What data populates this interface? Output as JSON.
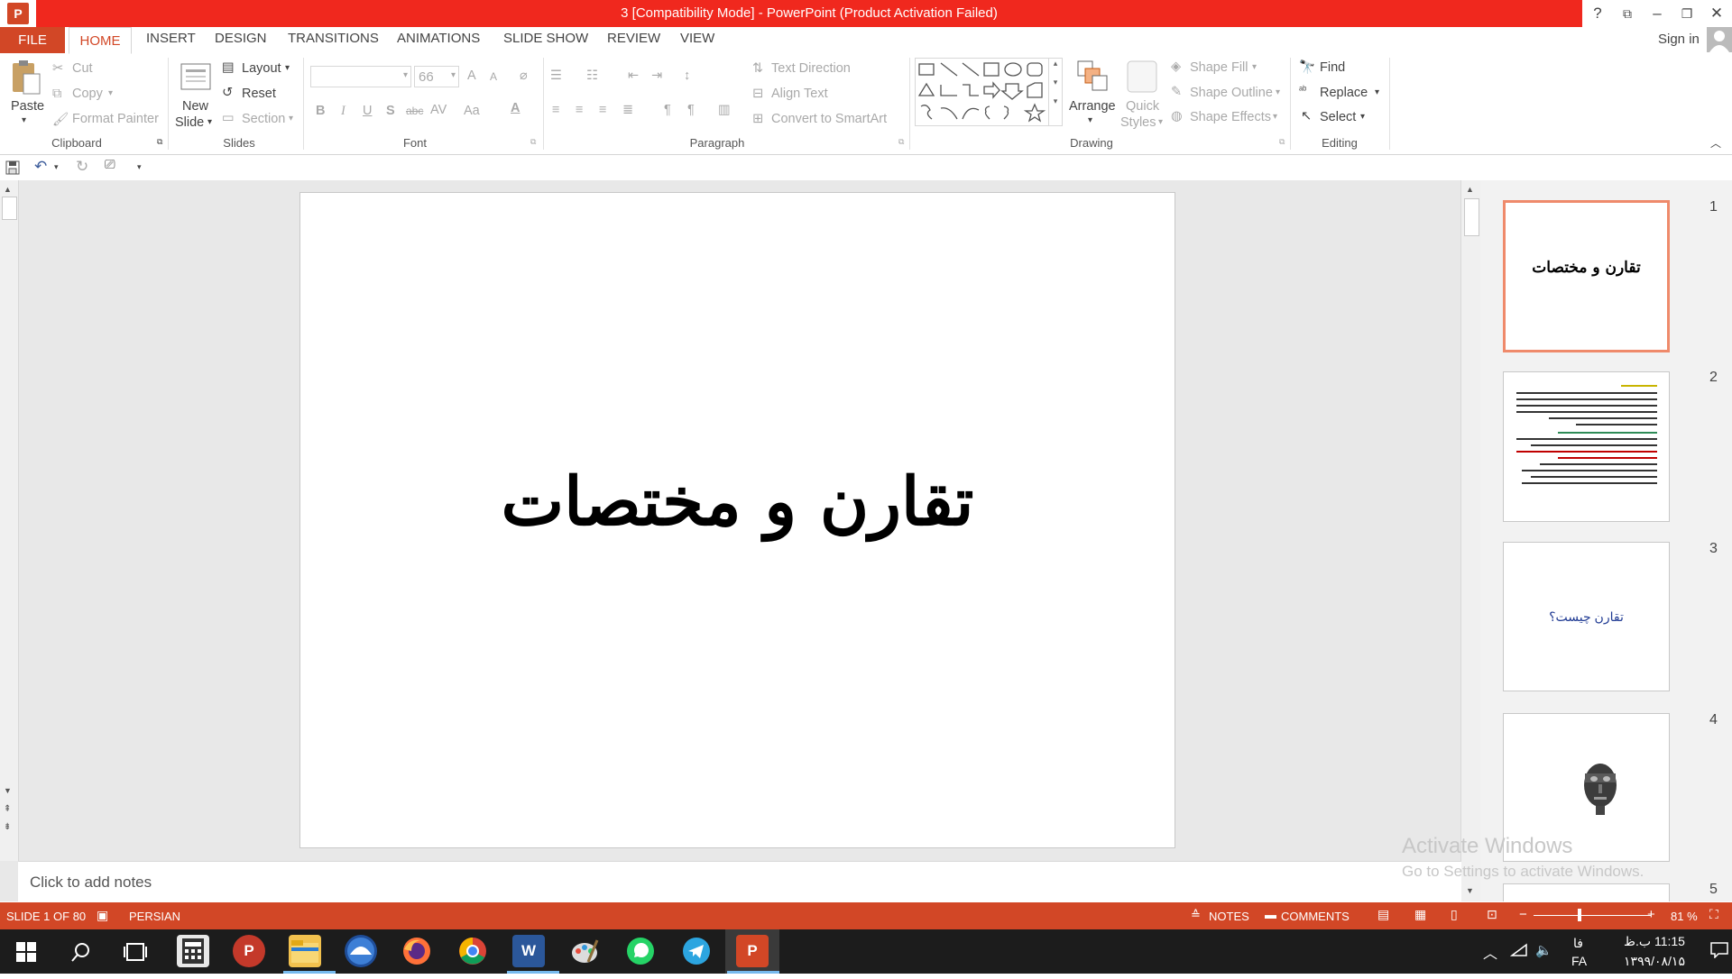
{
  "title_bar": {
    "title": "3 [Compatibility Mode] -  PowerPoint (Product Activation Failed)",
    "app_icon_letter": "P",
    "help": "?",
    "ribbon_display": "⧉",
    "minimize": "–",
    "restore": "❐",
    "close": "✕"
  },
  "tabs": [
    "FILE",
    "HOME",
    "INSERT",
    "DESIGN",
    "TRANSITIONS",
    "ANIMATIONS",
    "SLIDE SHOW",
    "REVIEW",
    "VIEW"
  ],
  "sign_in": "Sign in",
  "ribbon": {
    "clipboard": {
      "label": "Clipboard",
      "paste": "Paste",
      "cut": "Cut",
      "copy": "Copy",
      "format_painter": "Format Painter"
    },
    "slides": {
      "label": "Slides",
      "new_slide_line1": "New",
      "new_slide_line2": "Slide",
      "layout": "Layout",
      "reset": "Reset",
      "section": "Section"
    },
    "font": {
      "label": "Font",
      "font_name": "",
      "font_size": "66",
      "grow": "A",
      "shrink": "A",
      "bold": "B",
      "italic": "I",
      "underline": "U",
      "shadow": "S",
      "strike": "abc",
      "spacing": "AV",
      "case": "Aa",
      "color": "A"
    },
    "paragraph": {
      "label": "Paragraph",
      "text_direction": "Text Direction",
      "align_text": "Align Text",
      "convert_smartart": "Convert to SmartArt"
    },
    "drawing": {
      "label": "Drawing",
      "arrange": "Arrange",
      "quick_styles_line1": "Quick",
      "quick_styles_line2": "Styles",
      "shape_fill": "Shape Fill",
      "shape_outline": "Shape Outline",
      "shape_effects": "Shape Effects"
    },
    "editing": {
      "label": "Editing",
      "find": "Find",
      "replace": "Replace",
      "select": "Select"
    }
  },
  "slide": {
    "title": "تقارن و مختصات"
  },
  "thumbnails": [
    {
      "num": "1",
      "text": "تقارن و مختصات"
    },
    {
      "num": "2",
      "text": ""
    },
    {
      "num": "3",
      "text": "تقارن چیست؟"
    },
    {
      "num": "4",
      "text": ""
    },
    {
      "num": "5",
      "text": ""
    }
  ],
  "notes_placeholder": "Click to add notes",
  "activate": {
    "line1": "Activate Windows",
    "line2": "Go to Settings to activate Windows."
  },
  "status": {
    "slide_counter": "SLIDE 1 OF 80",
    "language": "PERSIAN",
    "notes": "NOTES",
    "comments": "COMMENTS",
    "zoom": "81 %",
    "zoom_level": 0.81,
    "zoom_minus": "−",
    "zoom_plus": "+"
  },
  "taskbar": {
    "time": "11:15 ب.ظ",
    "date": "۱۳۹۹/۰۸/۱۵",
    "lang_top": "فا",
    "lang_bottom": "FA"
  },
  "colors": {
    "title_red": "#f0281e",
    "accent": "#d24726",
    "active_thumb_border": "#ef8a6b"
  }
}
